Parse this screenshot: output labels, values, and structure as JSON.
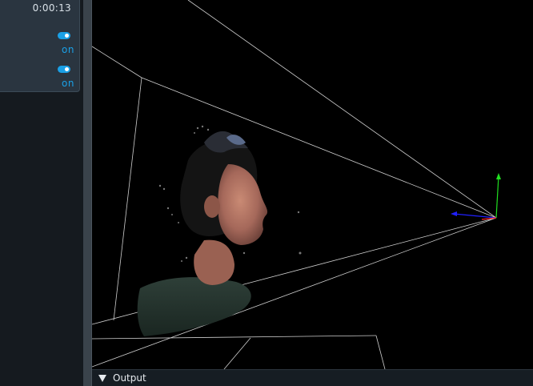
{
  "panel": {
    "elapsed_time": "0:00:13",
    "toggle_1": {
      "state": "on",
      "label": "on"
    },
    "toggle_2": {
      "state": "on",
      "label": "on"
    }
  },
  "viewport": {
    "axes_colors": {
      "x": "#ff2020",
      "y": "#20e020",
      "z": "#2020ff"
    },
    "background": "#000000"
  },
  "output_panel": {
    "label": "Output",
    "expanded": true
  }
}
